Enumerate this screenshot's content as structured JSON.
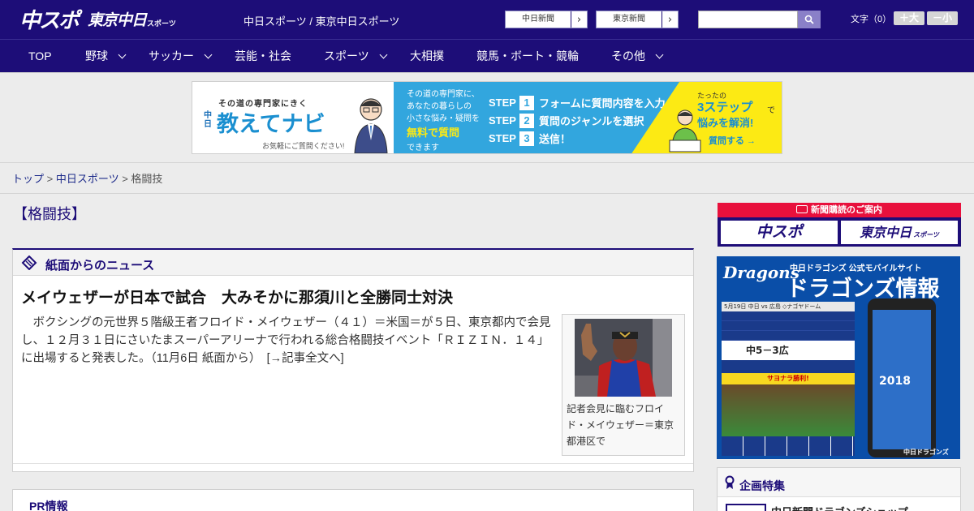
{
  "header": {
    "logo_chuspo": "中スポ",
    "logo_tokyo": "東京中日",
    "logo_sports": "スポーツ",
    "site_title": "中日スポーツ / 東京中日スポーツ",
    "paper_buttons": [
      "中日新聞",
      "東京新聞"
    ],
    "search": {
      "placeholder": ""
    },
    "font_size_label": "文字（0）",
    "font_larger": "＋大",
    "font_smaller": "－小",
    "accent_color": "#1d0d78"
  },
  "nav": {
    "items": [
      {
        "label": "TOP",
        "dropdown": false
      },
      {
        "label": "野球",
        "dropdown": true
      },
      {
        "label": "サッカー",
        "dropdown": true
      },
      {
        "label": "芸能・社会",
        "dropdown": false
      },
      {
        "label": "スポーツ",
        "dropdown": true
      },
      {
        "label": "大相撲",
        "dropdown": false
      },
      {
        "label": "競馬・ボート・競輪",
        "dropdown": false
      },
      {
        "label": "その他",
        "dropdown": true
      }
    ]
  },
  "banner": {
    "tagline": "その道の専門家にきく",
    "brand_small": "中日",
    "brand": "教えてナビ",
    "prompt": "お気軽にご質問ください!",
    "desc_lines": [
      "その道の専門家に、",
      "あなたの暮らしの",
      "小さな悩み・疑問を"
    ],
    "free": "無料で質問",
    "can": "できます",
    "steps": [
      {
        "label": "STEP",
        "num": "1",
        "text": "フォームに質問内容を入力"
      },
      {
        "label": "STEP",
        "num": "2",
        "text": "質問のジャンルを選択"
      },
      {
        "label": "STEP",
        "num": "3",
        "text": "送信！"
      }
    ],
    "right_top": "たったの",
    "right_steps": "3ステップ",
    "right_de": "で",
    "right_solve": "悩みを解消!",
    "ask": "質問する →"
  },
  "breadcrumb": {
    "top": "トップ",
    "sep": " > ",
    "parent": "中日スポーツ",
    "current": "格闘技"
  },
  "page_title": "【格闘技】",
  "news": {
    "heading": "紙面からのニュース",
    "article": {
      "title": "メイウェザーが日本で試合　大みそかに那須川と全勝同士対決",
      "body": "ボクシングの元世界５階級王者フロイド・メイウェザー（４１）＝米国＝が５日、東京都内で会見し、１２月３１日にさいたまスーパーアリーナで行われる総合格闘技イベント「ＲＩＺＩＮ．１４」に出場すると発表した。（11月6日 紙面から）",
      "more_link": "　[→記事全文へ]",
      "caption": "記者会見に臨むフロイド・メイウェザー＝東京都港区で"
    }
  },
  "pr": {
    "heading": "PR情報"
  },
  "sidebar": {
    "subscribe_heading": "新聞購読のご案内",
    "logo_chuspo": "中スポ",
    "logo_tokyo": "東京中日",
    "logo_tokyo_suffix": "スポーツ",
    "dragons": {
      "brand": "Dragons",
      "top_text": "中日ドラゴンズ 公式モバイルサイト",
      "title": "ドラゴンズ情報",
      "game_date": "5月19日 中日 vs 広島 ◇ナゴヤドーム",
      "score": "中5－3広",
      "sayonara": "サヨナラ勝利!",
      "year": "2018",
      "footer": "中日ドラゴンズ"
    },
    "plan_heading": "企画特集",
    "plan_item": "中日新聞ドラゴンズショップ"
  }
}
